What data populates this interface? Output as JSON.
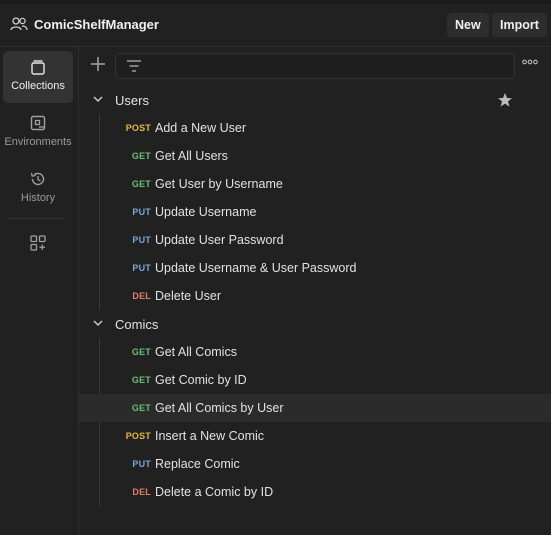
{
  "workspace": {
    "title": "ComicShelfManager"
  },
  "header": {
    "new_label": "New",
    "import_label": "Import"
  },
  "sidebar": {
    "items": [
      {
        "label": "Collections",
        "icon": "collections-icon",
        "active": true
      },
      {
        "label": "Environments",
        "icon": "environments-icon",
        "active": false
      },
      {
        "label": "History",
        "icon": "history-icon",
        "active": false
      }
    ],
    "extra_icon": "add-workspace-icon"
  },
  "colors": {
    "post": "#e5b548",
    "get": "#6bbf7c",
    "put": "#7ea3d8",
    "del": "#e07d6d"
  },
  "collections": [
    {
      "name": "Users",
      "starred": true,
      "requests": [
        {
          "method": "POST",
          "name": "Add a New User"
        },
        {
          "method": "GET",
          "name": "Get All Users"
        },
        {
          "method": "GET",
          "name": "Get User by Username"
        },
        {
          "method": "PUT",
          "name": "Update Username"
        },
        {
          "method": "PUT",
          "name": "Update User Password"
        },
        {
          "method": "PUT",
          "name": "Update Username & User Password"
        },
        {
          "method": "DEL",
          "name": "Delete User"
        }
      ]
    },
    {
      "name": "Comics",
      "starred": false,
      "requests": [
        {
          "method": "GET",
          "name": "Get All Comics"
        },
        {
          "method": "GET",
          "name": "Get Comic by ID"
        },
        {
          "method": "GET",
          "name": "Get All Comics by User",
          "selected": true
        },
        {
          "method": "POST",
          "name": "Insert a New Comic"
        },
        {
          "method": "PUT",
          "name": "Replace Comic"
        },
        {
          "method": "DEL",
          "name": "Delete a Comic by ID"
        }
      ]
    }
  ]
}
